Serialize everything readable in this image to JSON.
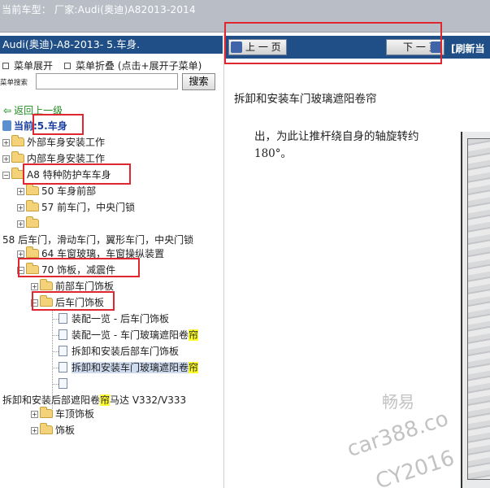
{
  "header": {
    "label": "当前车型：  厂家:Audi(奥迪)A82013-2014"
  },
  "left_panel": {
    "title": "Audi(奥迪)-A8-2013- 5.车身.",
    "menu_expand": "菜单展开",
    "menu_collapse": "菜单折叠 (点击+展开子菜单)",
    "search_label": "菜单搜索",
    "search_value": "",
    "search_button": "搜索",
    "back_link": "返回上一级",
    "current": "当前:5.车身",
    "tree": [
      "外部车身安装工作",
      "内部车身安装工作",
      "A8 特种防护车车身",
      "50 车身前部",
      "57 前车门，中央门锁",
      "",
      "58 后车门，滑动车门，翼形车门，中央门锁",
      "64 车窗玻璃，车窗操纵装置",
      "70 饰板，减震件",
      "前部车门饰板",
      "后车门饰板",
      "装配一览 - 后车门饰板",
      "装配一览 - 车门玻璃遮阳卷帘",
      "拆卸和安装后部车门饰板",
      "拆卸和安装车门玻璃遮阳卷帘",
      "",
      "拆卸和安装后部遮阳卷帘马达 V332/V333",
      "车顶饰板",
      "饰板"
    ],
    "highlight_char": "帘"
  },
  "right_panel": {
    "prev_button": "上 一 页",
    "next_button": "下 一 页",
    "refresh": "[刷新当",
    "page_title": "拆卸和安装车门玻璃遮阳卷帘",
    "paragraph": "出，为此让推杆绕自身的轴旋转约 180°。",
    "watermark_1": "畅易",
    "watermark_2": "car388.co",
    "watermark_3": "CY2016"
  },
  "colors": {
    "accent": "#1f4f86",
    "annotation": "#e0262e",
    "highlight": "#ffff2b"
  }
}
